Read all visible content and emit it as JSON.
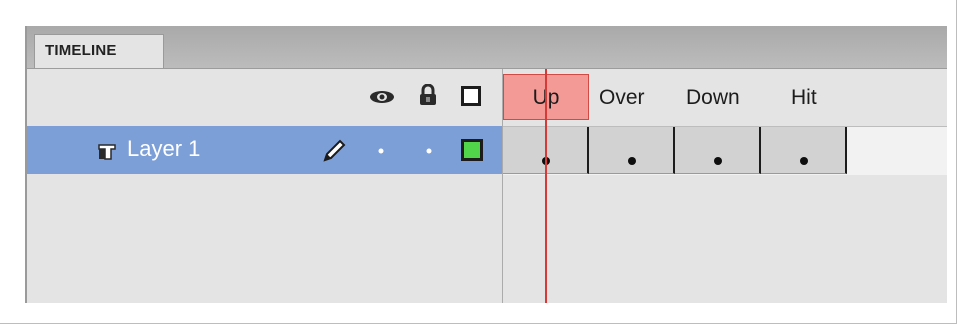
{
  "panel": {
    "tab_label": "TIMELINE"
  },
  "header": {
    "icons": [
      "eye-icon",
      "lock-icon",
      "outline-icon"
    ],
    "frame_labels": [
      "Up",
      "Over",
      "Down",
      "Hit"
    ]
  },
  "layers": [
    {
      "name": "Layer 1",
      "icons": [
        "layer-icon",
        "pencil-icon",
        "visibility-dot-icon",
        "lock-dot-icon",
        "outline-color-icon"
      ],
      "outline_color": "#52d44a",
      "selected_color": "#7d9fd8"
    }
  ],
  "frames": {
    "count_shown": 4,
    "keyframe_indicator_color": "#0e0e0e",
    "playhead_color": "#d63a36",
    "current_frame_label": "Up"
  }
}
